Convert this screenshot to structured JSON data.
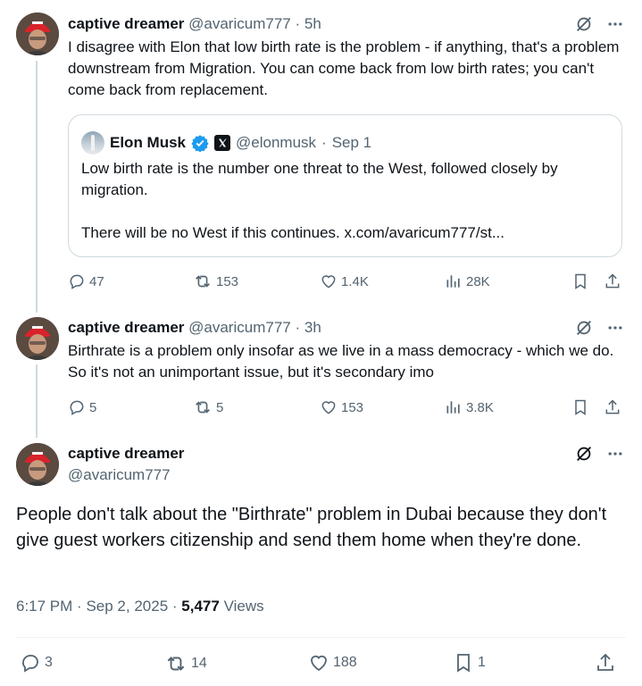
{
  "reply1": {
    "name": "captive dreamer",
    "handle": "@avaricum777",
    "sep": "·",
    "time": "5h",
    "text": "I disagree with Elon that low birth rate is the problem - if anything, that's a problem downstream from Migration.  You can come back from low birth rates; you can't come back from replacement.",
    "quote": {
      "name": "Elon Musk",
      "handle": "@elonmusk",
      "sep": "·",
      "date": "Sep 1",
      "line1": "Low birth rate is the number one threat to the West, followed closely by migration.",
      "line2": "There will be no West if this continues. x.com/avaricum777/st..."
    },
    "replies": "47",
    "reposts": "153",
    "likes": "1.4K",
    "views": "28K"
  },
  "reply2": {
    "name": "captive dreamer",
    "handle": "@avaricum777",
    "sep": "·",
    "time": "3h",
    "text": "Birthrate is a problem only insofar as we live in a mass democracy - which we do.  So it's not an unimportant issue, but it's secondary imo",
    "replies": "5",
    "reposts": "5",
    "likes": "153",
    "views": "3.8K"
  },
  "main": {
    "name": "captive dreamer",
    "handle": "@avaricum777",
    "text": "People don't talk about the \"Birthrate\" problem in Dubai because they don't give guest workers citizenship and send them home when they're done.",
    "time": "6:17 PM",
    "sep1": "·",
    "date": "Sep 2, 2025",
    "sep2": "·",
    "views_count": "5,477",
    "views_label": "Views",
    "replies": "3",
    "reposts": "14",
    "likes": "188",
    "bookmarks": "1"
  },
  "colors": {
    "text": "#0f1419",
    "muted": "#536471",
    "verified": "#1d9bf0",
    "border": "#cfd9de"
  }
}
